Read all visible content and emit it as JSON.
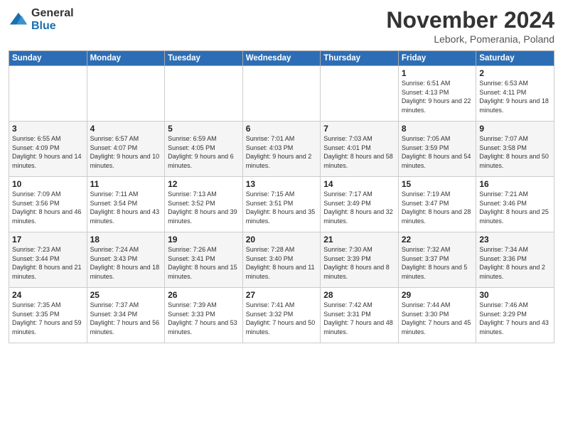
{
  "logo": {
    "general": "General",
    "blue": "Blue"
  },
  "title": "November 2024",
  "location": "Lebork, Pomerania, Poland",
  "weekdays": [
    "Sunday",
    "Monday",
    "Tuesday",
    "Wednesday",
    "Thursday",
    "Friday",
    "Saturday"
  ],
  "weeks": [
    [
      {
        "day": "",
        "info": ""
      },
      {
        "day": "",
        "info": ""
      },
      {
        "day": "",
        "info": ""
      },
      {
        "day": "",
        "info": ""
      },
      {
        "day": "",
        "info": ""
      },
      {
        "day": "1",
        "info": "Sunrise: 6:51 AM\nSunset: 4:13 PM\nDaylight: 9 hours and 22 minutes."
      },
      {
        "day": "2",
        "info": "Sunrise: 6:53 AM\nSunset: 4:11 PM\nDaylight: 9 hours and 18 minutes."
      }
    ],
    [
      {
        "day": "3",
        "info": "Sunrise: 6:55 AM\nSunset: 4:09 PM\nDaylight: 9 hours and 14 minutes."
      },
      {
        "day": "4",
        "info": "Sunrise: 6:57 AM\nSunset: 4:07 PM\nDaylight: 9 hours and 10 minutes."
      },
      {
        "day": "5",
        "info": "Sunrise: 6:59 AM\nSunset: 4:05 PM\nDaylight: 9 hours and 6 minutes."
      },
      {
        "day": "6",
        "info": "Sunrise: 7:01 AM\nSunset: 4:03 PM\nDaylight: 9 hours and 2 minutes."
      },
      {
        "day": "7",
        "info": "Sunrise: 7:03 AM\nSunset: 4:01 PM\nDaylight: 8 hours and 58 minutes."
      },
      {
        "day": "8",
        "info": "Sunrise: 7:05 AM\nSunset: 3:59 PM\nDaylight: 8 hours and 54 minutes."
      },
      {
        "day": "9",
        "info": "Sunrise: 7:07 AM\nSunset: 3:58 PM\nDaylight: 8 hours and 50 minutes."
      }
    ],
    [
      {
        "day": "10",
        "info": "Sunrise: 7:09 AM\nSunset: 3:56 PM\nDaylight: 8 hours and 46 minutes."
      },
      {
        "day": "11",
        "info": "Sunrise: 7:11 AM\nSunset: 3:54 PM\nDaylight: 8 hours and 43 minutes."
      },
      {
        "day": "12",
        "info": "Sunrise: 7:13 AM\nSunset: 3:52 PM\nDaylight: 8 hours and 39 minutes."
      },
      {
        "day": "13",
        "info": "Sunrise: 7:15 AM\nSunset: 3:51 PM\nDaylight: 8 hours and 35 minutes."
      },
      {
        "day": "14",
        "info": "Sunrise: 7:17 AM\nSunset: 3:49 PM\nDaylight: 8 hours and 32 minutes."
      },
      {
        "day": "15",
        "info": "Sunrise: 7:19 AM\nSunset: 3:47 PM\nDaylight: 8 hours and 28 minutes."
      },
      {
        "day": "16",
        "info": "Sunrise: 7:21 AM\nSunset: 3:46 PM\nDaylight: 8 hours and 25 minutes."
      }
    ],
    [
      {
        "day": "17",
        "info": "Sunrise: 7:23 AM\nSunset: 3:44 PM\nDaylight: 8 hours and 21 minutes."
      },
      {
        "day": "18",
        "info": "Sunrise: 7:24 AM\nSunset: 3:43 PM\nDaylight: 8 hours and 18 minutes."
      },
      {
        "day": "19",
        "info": "Sunrise: 7:26 AM\nSunset: 3:41 PM\nDaylight: 8 hours and 15 minutes."
      },
      {
        "day": "20",
        "info": "Sunrise: 7:28 AM\nSunset: 3:40 PM\nDaylight: 8 hours and 11 minutes."
      },
      {
        "day": "21",
        "info": "Sunrise: 7:30 AM\nSunset: 3:39 PM\nDaylight: 8 hours and 8 minutes."
      },
      {
        "day": "22",
        "info": "Sunrise: 7:32 AM\nSunset: 3:37 PM\nDaylight: 8 hours and 5 minutes."
      },
      {
        "day": "23",
        "info": "Sunrise: 7:34 AM\nSunset: 3:36 PM\nDaylight: 8 hours and 2 minutes."
      }
    ],
    [
      {
        "day": "24",
        "info": "Sunrise: 7:35 AM\nSunset: 3:35 PM\nDaylight: 7 hours and 59 minutes."
      },
      {
        "day": "25",
        "info": "Sunrise: 7:37 AM\nSunset: 3:34 PM\nDaylight: 7 hours and 56 minutes."
      },
      {
        "day": "26",
        "info": "Sunrise: 7:39 AM\nSunset: 3:33 PM\nDaylight: 7 hours and 53 minutes."
      },
      {
        "day": "27",
        "info": "Sunrise: 7:41 AM\nSunset: 3:32 PM\nDaylight: 7 hours and 50 minutes."
      },
      {
        "day": "28",
        "info": "Sunrise: 7:42 AM\nSunset: 3:31 PM\nDaylight: 7 hours and 48 minutes."
      },
      {
        "day": "29",
        "info": "Sunrise: 7:44 AM\nSunset: 3:30 PM\nDaylight: 7 hours and 45 minutes."
      },
      {
        "day": "30",
        "info": "Sunrise: 7:46 AM\nSunset: 3:29 PM\nDaylight: 7 hours and 43 minutes."
      }
    ]
  ]
}
